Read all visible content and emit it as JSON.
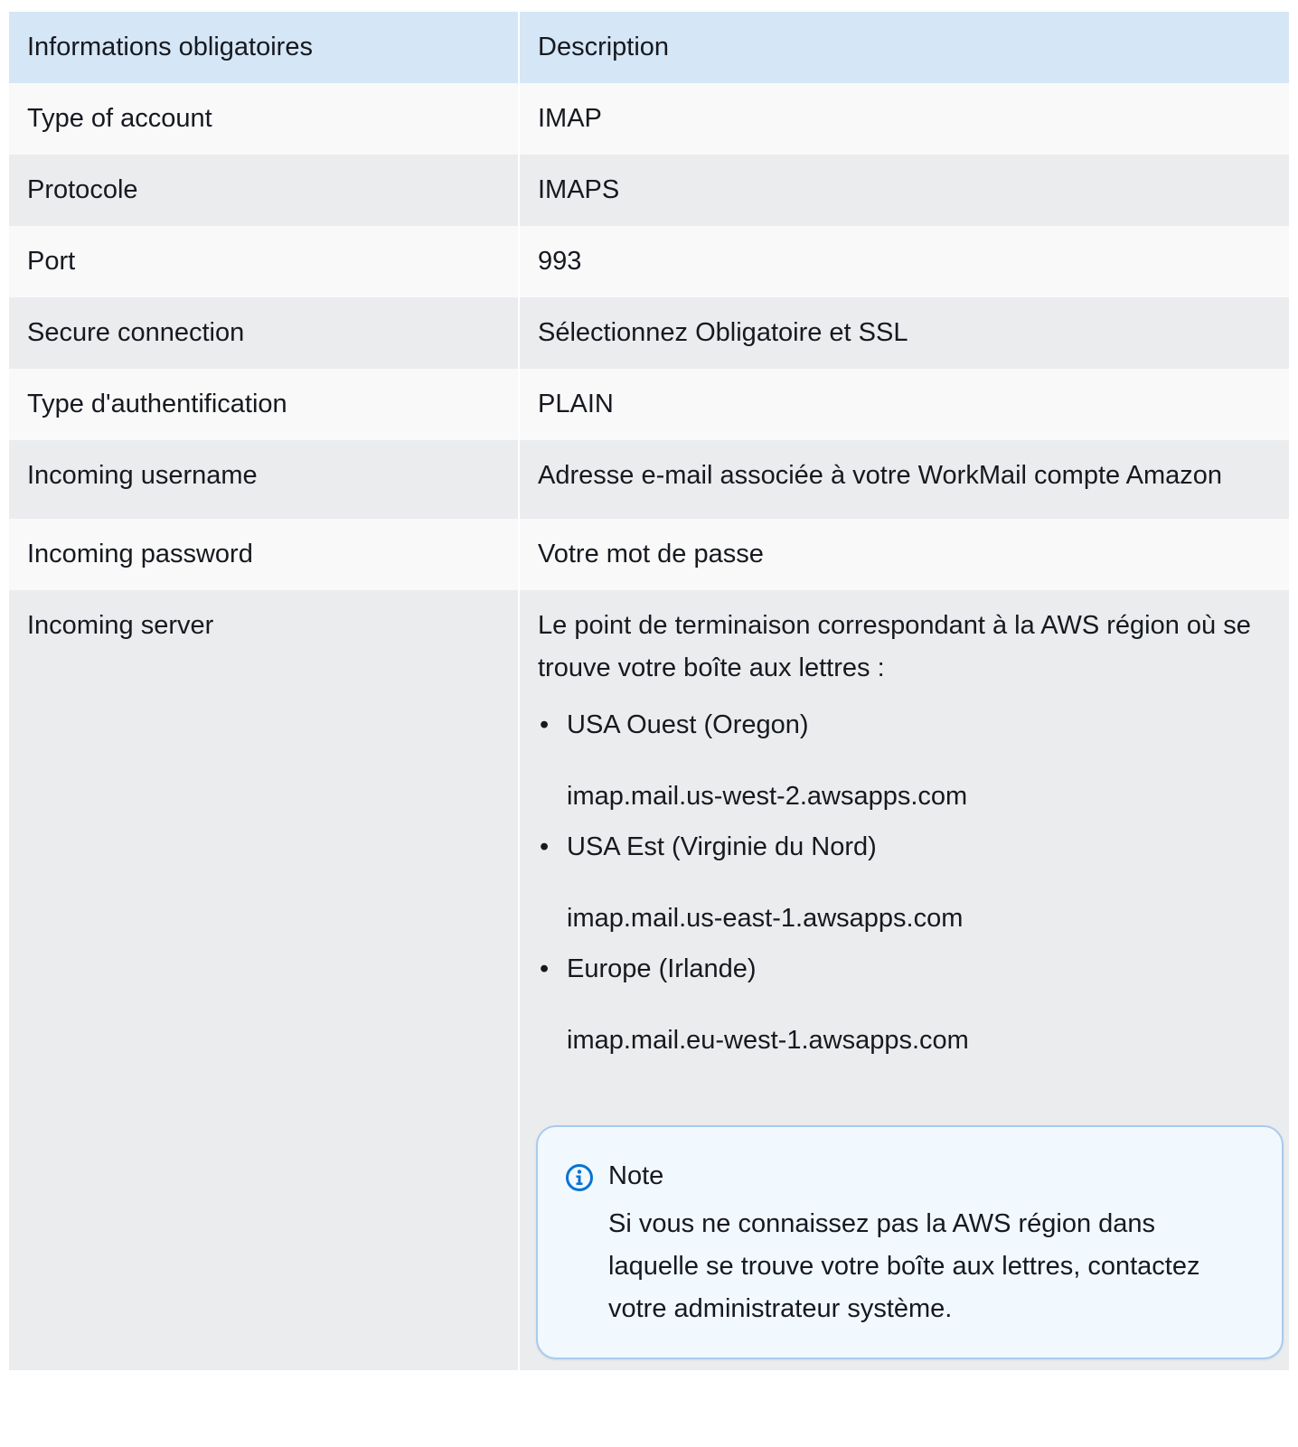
{
  "table": {
    "headers": [
      "Informations obligatoires",
      "Description"
    ],
    "rows": [
      {
        "label": "Type of account",
        "value": "IMAP"
      },
      {
        "label": "Protocole",
        "value": "IMAPS"
      },
      {
        "label": "Port",
        "value": "993"
      },
      {
        "label": "Secure connection",
        "value": "Sélectionnez Obligatoire et SSL"
      },
      {
        "label": "Type d'authentification",
        "value": "PLAIN"
      },
      {
        "label": "Incoming username",
        "value": "Adresse e-mail associée à votre WorkMail compte Amazon"
      },
      {
        "label": "Incoming password",
        "value": "Votre mot de passe"
      },
      {
        "label": "Incoming server",
        "value": "Le point de terminaison correspondant à la AWS région où se trouve votre boîte aux lettres :"
      }
    ]
  },
  "regions": [
    {
      "bullet": "•",
      "name": "USA Ouest (Oregon)",
      "endpoint": "imap.mail.us-west-2.awsapps.com"
    },
    {
      "bullet": "•",
      "name": "USA Est (Virginie du Nord)",
      "endpoint": "imap.mail.us-east-1.awsapps.com"
    },
    {
      "bullet": "•",
      "name": "Europe (Irlande)",
      "endpoint": "imap.mail.eu-west-1.awsapps.com"
    }
  ],
  "note": {
    "icon": "info-icon",
    "title": "Note",
    "text": "Si vous ne connaissez pas la AWS région dans laquelle se trouve votre boîte aux lettres, contactez votre administrateur système."
  },
  "colors": {
    "header_bg": "#d5e6f6",
    "row_odd": "#f9f9f9",
    "row_even": "#ebecee",
    "note_border": "#a8cbee",
    "note_bg": "#f1f8fe",
    "icon_blue": "#0972d3"
  }
}
